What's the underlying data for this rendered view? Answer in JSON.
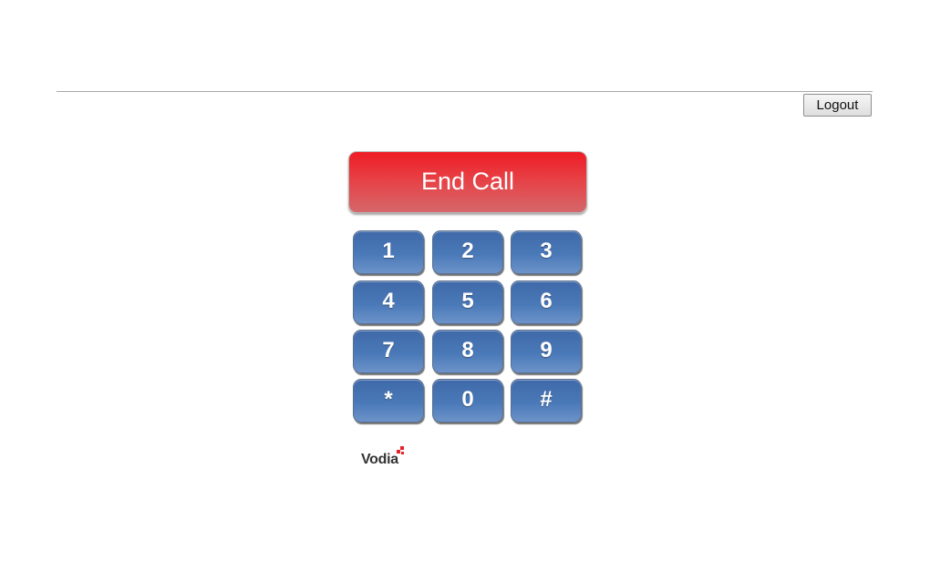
{
  "header": {
    "logout_label": "Logout"
  },
  "call": {
    "end_call_label": "End Call",
    "end_call_color": "#ee1c25"
  },
  "keypad": {
    "color": "#4a79b8",
    "keys": [
      "1",
      "2",
      "3",
      "4",
      "5",
      "6",
      "7",
      "8",
      "9",
      "*",
      "0",
      "#"
    ]
  },
  "brand": {
    "logo_text": "Vodia",
    "accent_color": "#e8202a"
  }
}
